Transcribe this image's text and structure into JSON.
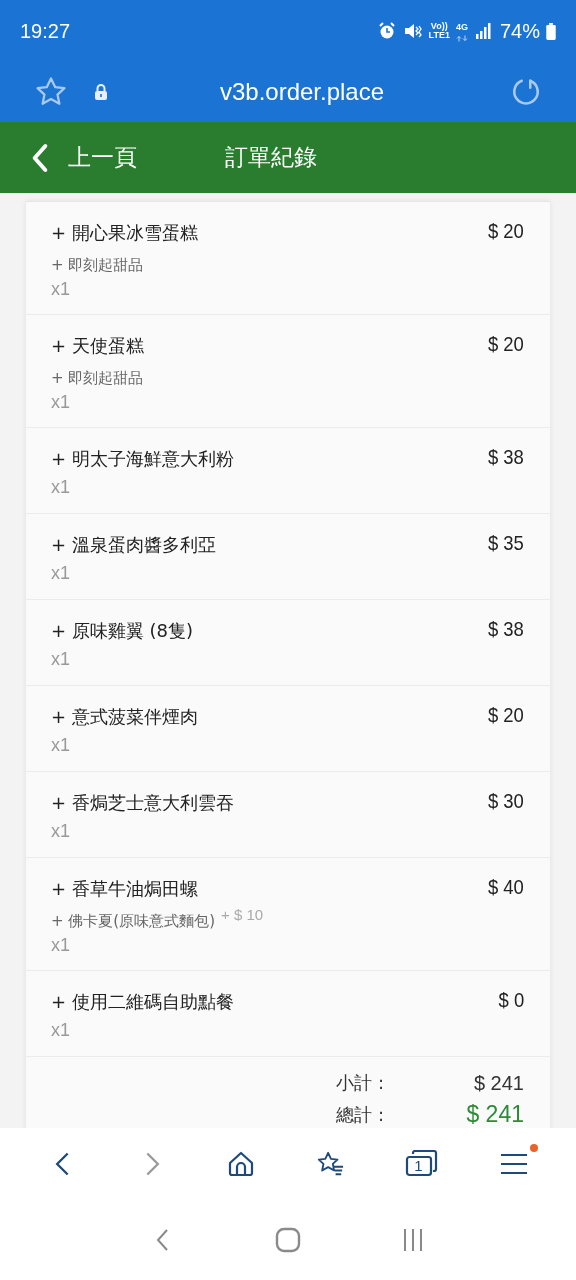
{
  "status_bar": {
    "time": "19:27",
    "volte_top": "Vo))",
    "volte_bottom": "LTE1",
    "network": "4G",
    "battery": "74%"
  },
  "browser_bar": {
    "url": "v3b.order.place"
  },
  "header": {
    "back_label": "上一頁",
    "title": "訂單紀錄"
  },
  "items": [
    {
      "name": "+ 開心果冰雪蛋糕",
      "price": "$ 20",
      "options": [
        {
          "label": "+ 即刻起甜品"
        }
      ],
      "quantity": "x1"
    },
    {
      "name": "+ 天使蛋糕",
      "price": "$ 20",
      "options": [
        {
          "label": "+ 即刻起甜品"
        }
      ],
      "quantity": "x1"
    },
    {
      "name": "+ 明太子海鮮意大利粉",
      "price": "$ 38",
      "quantity": "x1"
    },
    {
      "name": "+ 溫泉蛋肉醬多利亞",
      "price": "$ 35",
      "quantity": "x1"
    },
    {
      "name": "+ 原味雞翼 (8隻)",
      "price": "$ 38",
      "quantity": "x1"
    },
    {
      "name": "+ 意式菠菜伴煙肉",
      "price": "$ 20",
      "quantity": "x1"
    },
    {
      "name": "+ 香焗芝士意大利雲吞",
      "price": "$ 30",
      "quantity": "x1"
    },
    {
      "name": "+ 香草牛油焗田螺",
      "price": "$ 40",
      "options": [
        {
          "label": "+ 佛卡夏(原味意式麵包)",
          "extra": "+ $ 10"
        }
      ],
      "quantity": "x1"
    },
    {
      "name": "+ 使用二維碼自助點餐",
      "price": "$ 0",
      "quantity": "x1"
    }
  ],
  "summary": [
    {
      "kind": "subtotal",
      "label": "小計 :",
      "value": "$ 241"
    },
    {
      "kind": "total",
      "label": "總計 :",
      "value": "$ 241"
    }
  ],
  "bottom_nav": {
    "forward_disabled": true,
    "tab_count": "1",
    "menu_badge": true
  }
}
